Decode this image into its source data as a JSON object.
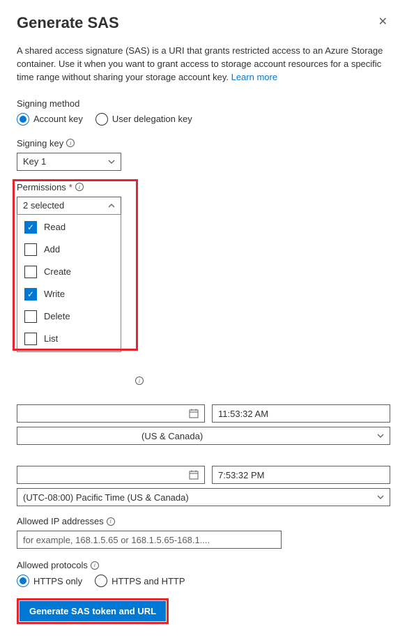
{
  "header": {
    "title": "Generate SAS"
  },
  "description": {
    "text": "A shared access signature (SAS) is a URI that grants restricted access to an Azure Storage container. Use it when you want to grant access to storage account resources for a specific time range without sharing your storage account key. ",
    "learn_more": "Learn more"
  },
  "signing_method": {
    "label": "Signing method",
    "options": {
      "account": "Account key",
      "delegation": "User delegation key"
    },
    "selected": "account"
  },
  "signing_key": {
    "label": "Signing key",
    "value": "Key 1"
  },
  "permissions": {
    "label": "Permissions",
    "selected_text": "2 selected",
    "items": [
      {
        "label": "Read",
        "checked": true
      },
      {
        "label": "Add",
        "checked": false
      },
      {
        "label": "Create",
        "checked": false
      },
      {
        "label": "Write",
        "checked": true
      },
      {
        "label": "Delete",
        "checked": false
      },
      {
        "label": "List",
        "checked": false
      }
    ]
  },
  "start": {
    "time": "11:53:32 AM",
    "timezone": "(US & Canada)"
  },
  "expiry": {
    "tz_prefix": "(UTC-08:00) Pacific Time ",
    "time": "7:53:32 PM",
    "timezone": "(US & Canada)"
  },
  "allowed_ip": {
    "label": "Allowed IP addresses",
    "placeholder": "for example, 168.1.5.65 or 168.1.5.65-168.1...."
  },
  "allowed_protocols": {
    "label": "Allowed protocols",
    "options": {
      "https": "HTTPS only",
      "both": "HTTPS and HTTP"
    },
    "selected": "https"
  },
  "button": {
    "generate": "Generate SAS token and URL"
  }
}
